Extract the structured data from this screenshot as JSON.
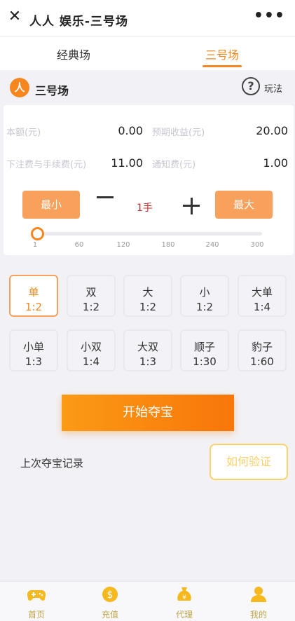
{
  "app": {
    "title": "人人 娱乐-三号场"
  },
  "tabs": [
    {
      "label": "经典场"
    },
    {
      "label": "三号场"
    }
  ],
  "room": {
    "name": "三号场",
    "logo_text": "人",
    "help_label": "玩法"
  },
  "stats": {
    "principal_label": "本额(元)",
    "principal_value": "0.00",
    "expected_label": "预期收益(元)",
    "expected_value": "20.00",
    "fee_label": "下注费与手续费(元)",
    "fee_value": "11.00",
    "notify_label": "通知费(元)",
    "notify_value": "1.00"
  },
  "qty": {
    "min_label": "最小",
    "max_label": "最大",
    "value": "1手"
  },
  "slider": {
    "ticks": [
      "1",
      "60",
      "120",
      "180",
      "240",
      "300"
    ],
    "value": 1
  },
  "bets": [
    {
      "name": "单",
      "odds": "1:2",
      "selected": true
    },
    {
      "name": "双",
      "odds": "1:2"
    },
    {
      "name": "大",
      "odds": "1:2"
    },
    {
      "name": "小",
      "odds": "1:2"
    },
    {
      "name": "大单",
      "odds": "1:4"
    },
    {
      "name": "小单",
      "odds": "1:3"
    },
    {
      "name": "小双",
      "odds": "1:4"
    },
    {
      "name": "大双",
      "odds": "1:3"
    },
    {
      "name": "顺子",
      "odds": "1:30"
    },
    {
      "name": "豹子",
      "odds": "1:60"
    }
  ],
  "actions": {
    "start": "开始夺宝",
    "history": "上次夺宝记录",
    "verify": "如何验证"
  },
  "nav": [
    {
      "label": "首页",
      "icon": "gamepad-icon"
    },
    {
      "label": "充值",
      "icon": "coin-icon"
    },
    {
      "label": "代理",
      "icon": "moneybag-icon"
    },
    {
      "label": "我的",
      "icon": "user-icon"
    }
  ],
  "colors": {
    "accent": "#f7861f",
    "nav_gold": "#f5b81e",
    "verify": "#fbd26a"
  }
}
